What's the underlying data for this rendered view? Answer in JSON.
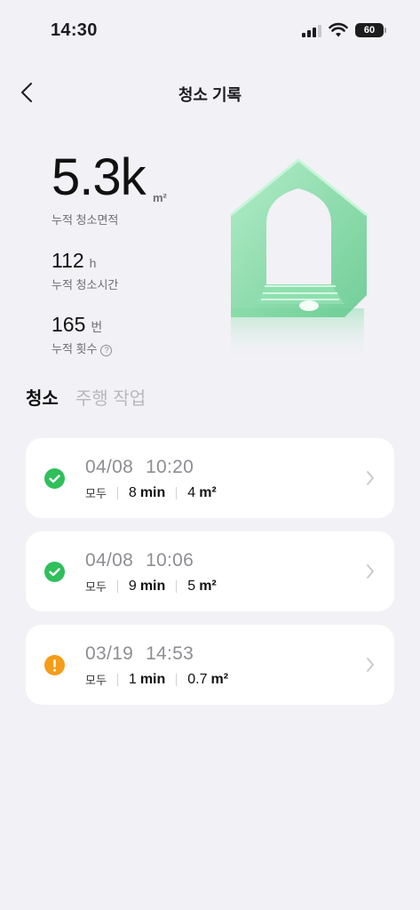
{
  "status_bar": {
    "time": "14:30",
    "battery": "60"
  },
  "header": {
    "title": "청소 기록"
  },
  "stats": {
    "area_value": "5.3k",
    "area_unit": "m²",
    "area_label": "누적 청소면적",
    "time_value": "112",
    "time_unit": "h",
    "time_label": "누적 청소시간",
    "count_value": "165",
    "count_unit": "번",
    "count_label": "누적 횟수",
    "help_symbol": "?"
  },
  "tabs": [
    {
      "label": "청소"
    },
    {
      "label": "주행 작업"
    }
  ],
  "records": [
    {
      "date": "04/08",
      "time": "10:20",
      "status": "success",
      "mode": "모두",
      "duration": "8",
      "duration_unit": "min",
      "area": "4",
      "area_unit": "m²"
    },
    {
      "date": "04/08",
      "time": "10:06",
      "status": "success",
      "mode": "모두",
      "duration": "9",
      "duration_unit": "min",
      "area": "5",
      "area_unit": "m²"
    },
    {
      "date": "03/19",
      "time": "14:53",
      "status": "warning",
      "mode": "모두",
      "duration": "1",
      "duration_unit": "min",
      "area": "0.7",
      "area_unit": "m²"
    }
  ],
  "colors": {
    "success": "#2fbf5b",
    "warning": "#f59c18",
    "background": "#f2f1f6"
  },
  "icons": {
    "back": "chevron-left-icon",
    "success": "check-circle-icon",
    "warning": "exclamation-circle-icon",
    "detail": "chevron-right-icon"
  }
}
